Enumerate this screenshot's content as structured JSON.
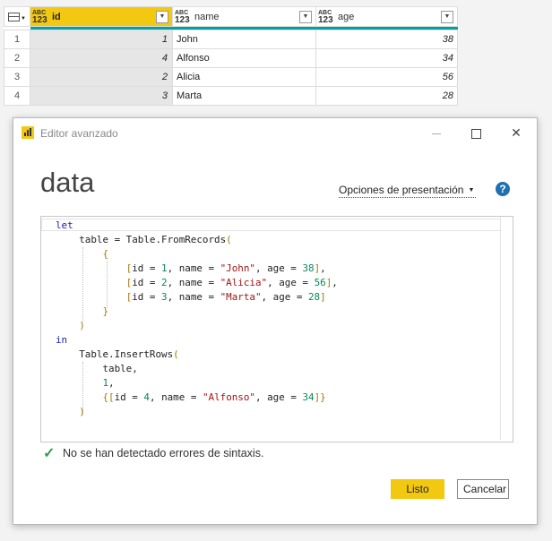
{
  "grid": {
    "columns": [
      {
        "type_top": "ABC",
        "type_bottom": "123",
        "name": "id"
      },
      {
        "type_top": "ABC",
        "type_bottom": "123",
        "name": "name"
      },
      {
        "type_top": "ABC",
        "type_bottom": "123",
        "name": "age"
      }
    ],
    "rows": [
      {
        "num": "1",
        "id": "1",
        "name": "John",
        "age": "38"
      },
      {
        "num": "2",
        "id": "4",
        "name": "Alfonso",
        "age": "34"
      },
      {
        "num": "3",
        "id": "2",
        "name": "Alicia",
        "age": "56"
      },
      {
        "num": "4",
        "id": "3",
        "name": "Marta",
        "age": "28"
      }
    ],
    "accent_color": "#f2c811",
    "quality_bar_color": "#00a3a3"
  },
  "dialog": {
    "title": "Editor avanzado",
    "query_name": "data",
    "display_options_label": "Opciones de presentación",
    "help_label": "?",
    "status_text": "No se han detectado errores de sintaxis.",
    "ok_label": "Listo",
    "cancel_label": "Cancelar",
    "code_lines": [
      "let",
      "    table = Table.FromRecords(",
      "        {",
      "            [id = 1, name = \"John\", age = 38],",
      "            [id = 2, name = \"Alicia\", age = 56],",
      "            [id = 3, name = \"Marta\", age = 28]",
      "        }",
      "    )",
      "in",
      "    Table.InsertRows(",
      "        table,",
      "        1,",
      "        {[id = 4, name = \"Alfonso\", age = 34]}",
      "    )"
    ]
  }
}
